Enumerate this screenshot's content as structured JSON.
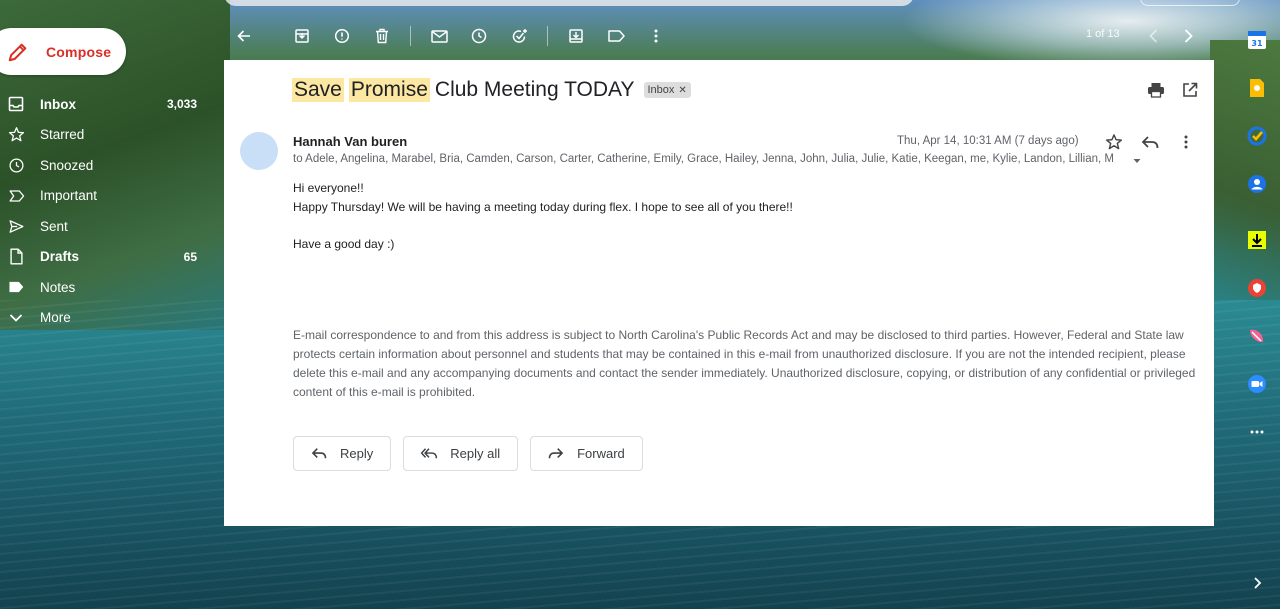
{
  "compose": {
    "label": "Compose"
  },
  "nav": {
    "items": [
      {
        "label": "Inbox",
        "count": "3,033",
        "icon": "inbox-icon",
        "bold": true
      },
      {
        "label": "Starred",
        "count": "",
        "icon": "star-icon",
        "bold": false
      },
      {
        "label": "Snoozed",
        "count": "",
        "icon": "clock-icon",
        "bold": false
      },
      {
        "label": "Important",
        "count": "",
        "icon": "important-icon",
        "bold": false
      },
      {
        "label": "Sent",
        "count": "",
        "icon": "send-icon",
        "bold": false
      },
      {
        "label": "Drafts",
        "count": "65",
        "icon": "draft-icon",
        "bold": true
      },
      {
        "label": "Notes",
        "count": "",
        "icon": "label-icon",
        "bold": false
      },
      {
        "label": "More",
        "count": "",
        "icon": "chevron-down-icon",
        "bold": false
      }
    ]
  },
  "toolbar": {
    "pager": "1 of 13"
  },
  "message": {
    "subject_parts": [
      "Save",
      "Promise",
      "Club Meeting TODAY"
    ],
    "tag": "Inbox",
    "sender": "Hannah Van buren",
    "recipients": "to Adele, Angelina, Marabel, Bria, Camden, Carson, Carter, Catherine, Emily, Grace, Hailey, Jenna, John, Julia, Julie, Katie, Keegan, me, Kylie, Landon, Lillian, M",
    "date": "Thu, Apr 14, 10:31 AM (7 days ago)",
    "body": {
      "line1": "Hi everyone!!",
      "line2": "Happy Thursday! We will be having a meeting today during flex. I hope to see all of you there!!",
      "line3": "Have a good day :)"
    },
    "disclaimer": "E-mail correspondence to and from this address is subject to North Carolina's Public Records Act and may be disclosed to third parties. However, Federal and State law protects certain information about personnel and students that may be contained in this e-mail from unauthorized disclosure. If you are not the intended recipient, please delete this e-mail and any accompanying documents and contact the sender immediately. Unauthorized disclosure, copying, or distribution of any confidential or privileged content of this e-mail is prohibited."
  },
  "actions": {
    "reply": "Reply",
    "reply_all": "Reply all",
    "forward": "Forward"
  },
  "colors": {
    "compose_text": "#d93025",
    "highlight": "#fce8a3",
    "avatar": "#c9def7"
  }
}
